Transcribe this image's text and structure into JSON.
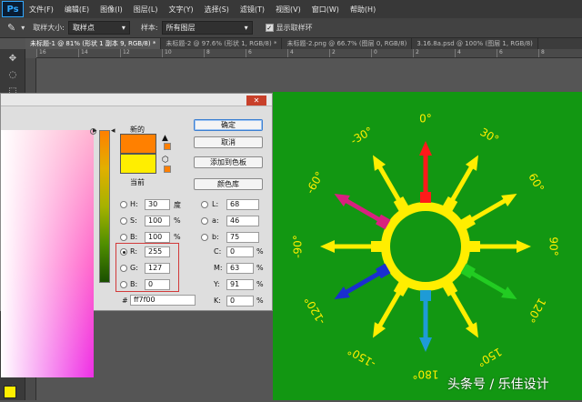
{
  "app": {
    "logo": "Ps"
  },
  "menu": [
    "文件(F)",
    "编辑(E)",
    "图像(I)",
    "图层(L)",
    "文字(Y)",
    "选择(S)",
    "滤镜(T)",
    "视图(V)",
    "窗口(W)",
    "帮助(H)"
  ],
  "options": {
    "sample_size_label": "取样大小:",
    "sample_size_value": "取样点",
    "sample_label": "样本:",
    "sample_value": "所有图层",
    "show_ring_label": "显示取样环",
    "show_ring_checked": true
  },
  "doc_tabs": [
    {
      "label": "未标题-1 @ 81% (形状 1 副本 9, RGB/8) *",
      "active": true
    },
    {
      "label": "未标题-2 @ 97.6% (形状 1, RGB/8) *",
      "active": false
    },
    {
      "label": "未标题-2.png @ 66.7% (图层 0, RGB/8)",
      "active": false
    },
    {
      "label": "3.16.8a.psd @ 100% (图层 1, RGB/8)",
      "active": false
    }
  ],
  "ruler_ticks": [
    "16",
    "14",
    "12",
    "10",
    "8",
    "6",
    "4",
    "2",
    "0",
    "2",
    "4",
    "6",
    "8"
  ],
  "dialog": {
    "new_label": "新的",
    "current_label": "当前",
    "new_color": "#ff8000",
    "current_color": "#ffee00",
    "buttons": {
      "ok": "确定",
      "cancel": "取消",
      "add_swatch": "添加到色板",
      "libraries": "颜色库"
    },
    "hsb": {
      "h_label": "H:",
      "h": "30",
      "h_unit": "度",
      "s_label": "S:",
      "s": "100",
      "s_unit": "%",
      "b_label": "B:",
      "b": "100",
      "b_unit": "%"
    },
    "lab": {
      "l_label": "L:",
      "l": "68",
      "a_label": "a:",
      "a": "46",
      "b_label": "b:",
      "b": "75"
    },
    "rgb": {
      "r_label": "R:",
      "r": "255",
      "g_label": "G:",
      "g": "127",
      "b_label": "B:",
      "b": "0",
      "selected": "R"
    },
    "cmyk": {
      "c_label": "C:",
      "c": "0",
      "m_label": "M:",
      "m": "63",
      "y_label": "Y:",
      "y": "91",
      "k_label": "K:",
      "k": "0",
      "unit": "%"
    },
    "hex_label": "#",
    "hex": "ff7f00"
  },
  "artwork": {
    "background": "#129712",
    "angles": [
      {
        "label": "0°"
      },
      {
        "label": "30°"
      },
      {
        "label": "60°"
      },
      {
        "label": "90°"
      },
      {
        "label": "120°"
      },
      {
        "label": "150°"
      },
      {
        "label": "180°"
      },
      {
        "label": "-150°"
      },
      {
        "label": "-120°"
      },
      {
        "label": "-90°"
      },
      {
        "label": "-60°"
      },
      {
        "label": "-30°"
      }
    ],
    "arrow_colors": [
      "#ff1a1a",
      "#ffee00",
      "#ffee00",
      "#ffee00",
      "#22cc22",
      "#ffee00",
      "#1e9bd6",
      "#ffee00",
      "#1a2fd0",
      "#ffee00",
      "#d8207f",
      "#ffee00"
    ]
  },
  "watermark": "头条号 / 乐佳设计"
}
